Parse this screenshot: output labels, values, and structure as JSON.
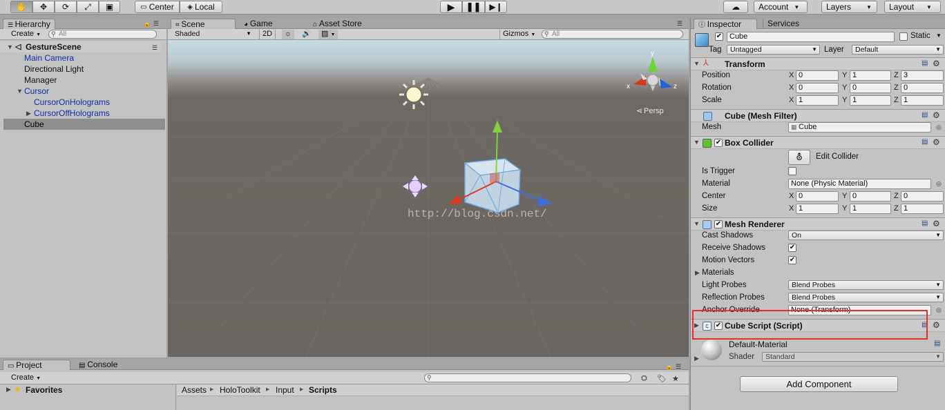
{
  "toolbar": {
    "pivot": "Center",
    "space": "Local",
    "account": "Account",
    "layers": "Layers",
    "layout": "Layout"
  },
  "hierarchy": {
    "tab": "Hierarchy",
    "create": "Create",
    "search_placeholder": "All",
    "scene_name": "GestureScene",
    "items": [
      {
        "label": "Main Camera"
      },
      {
        "label": "Directional Light"
      },
      {
        "label": "Manager"
      },
      {
        "label": "Cursor"
      },
      {
        "label": "CursorOnHolograms"
      },
      {
        "label": "CursorOffHolograms"
      },
      {
        "label": "Cube"
      }
    ]
  },
  "scene": {
    "tabs": [
      "Scene",
      "Game",
      "Asset Store"
    ],
    "shading": "Shaded",
    "mode_2d": "2D",
    "gizmos": "Gizmos",
    "search_placeholder": "All",
    "persp_label": "Persp",
    "axis_x": "x",
    "axis_y": "y",
    "axis_z": "z",
    "watermark": "http://blog.csdn.net/"
  },
  "inspector": {
    "tabs": [
      "Inspector",
      "Services"
    ],
    "object_name": "Cube",
    "static_label": "Static",
    "tag_label": "Tag",
    "tag_value": "Untagged",
    "layer_label": "Layer",
    "layer_value": "Default",
    "transform": {
      "title": "Transform",
      "position_label": "Position",
      "position": [
        "0",
        "1",
        "3"
      ],
      "rotation_label": "Rotation",
      "rotation": [
        "0",
        "0",
        "0"
      ],
      "scale_label": "Scale",
      "scale": [
        "1",
        "1",
        "1"
      ]
    },
    "mesh_filter": {
      "title": "Cube (Mesh Filter)",
      "mesh_label": "Mesh",
      "mesh_value": "Cube"
    },
    "box_collider": {
      "title": "Box Collider",
      "edit_collider": "Edit Collider",
      "is_trigger_label": "Is Trigger",
      "material_label": "Material",
      "material_value": "None (Physic Material)",
      "center_label": "Center",
      "center": [
        "0",
        "0",
        "0"
      ],
      "size_label": "Size",
      "size": [
        "1",
        "1",
        "1"
      ]
    },
    "mesh_renderer": {
      "title": "Mesh Renderer",
      "cast_shadows_label": "Cast Shadows",
      "cast_shadows_value": "On",
      "receive_shadows_label": "Receive Shadows",
      "motion_vectors_label": "Motion Vectors",
      "materials_label": "Materials",
      "light_probes_label": "Light Probes",
      "light_probes_value": "Blend Probes",
      "reflection_probes_label": "Reflection Probes",
      "reflection_probes_value": "Blend Probes",
      "anchor_override_label": "Anchor Override",
      "anchor_override_value": "None (Transform)"
    },
    "cube_script": {
      "title": "Cube Script (Script)"
    },
    "material": {
      "name": "Default-Material",
      "shader_label": "Shader",
      "shader_value": "Standard"
    },
    "add_component": "Add Component"
  },
  "project": {
    "tabs": [
      "Project",
      "Console"
    ],
    "create": "Create",
    "favorites": "Favorites",
    "breadcrumb": [
      "Assets",
      "HoloToolkit",
      "Input",
      "Scripts"
    ]
  },
  "colors": {
    "highlight_box": "#e8302a",
    "selection": "#8f8f8f",
    "link_blue": "#102fa8"
  }
}
